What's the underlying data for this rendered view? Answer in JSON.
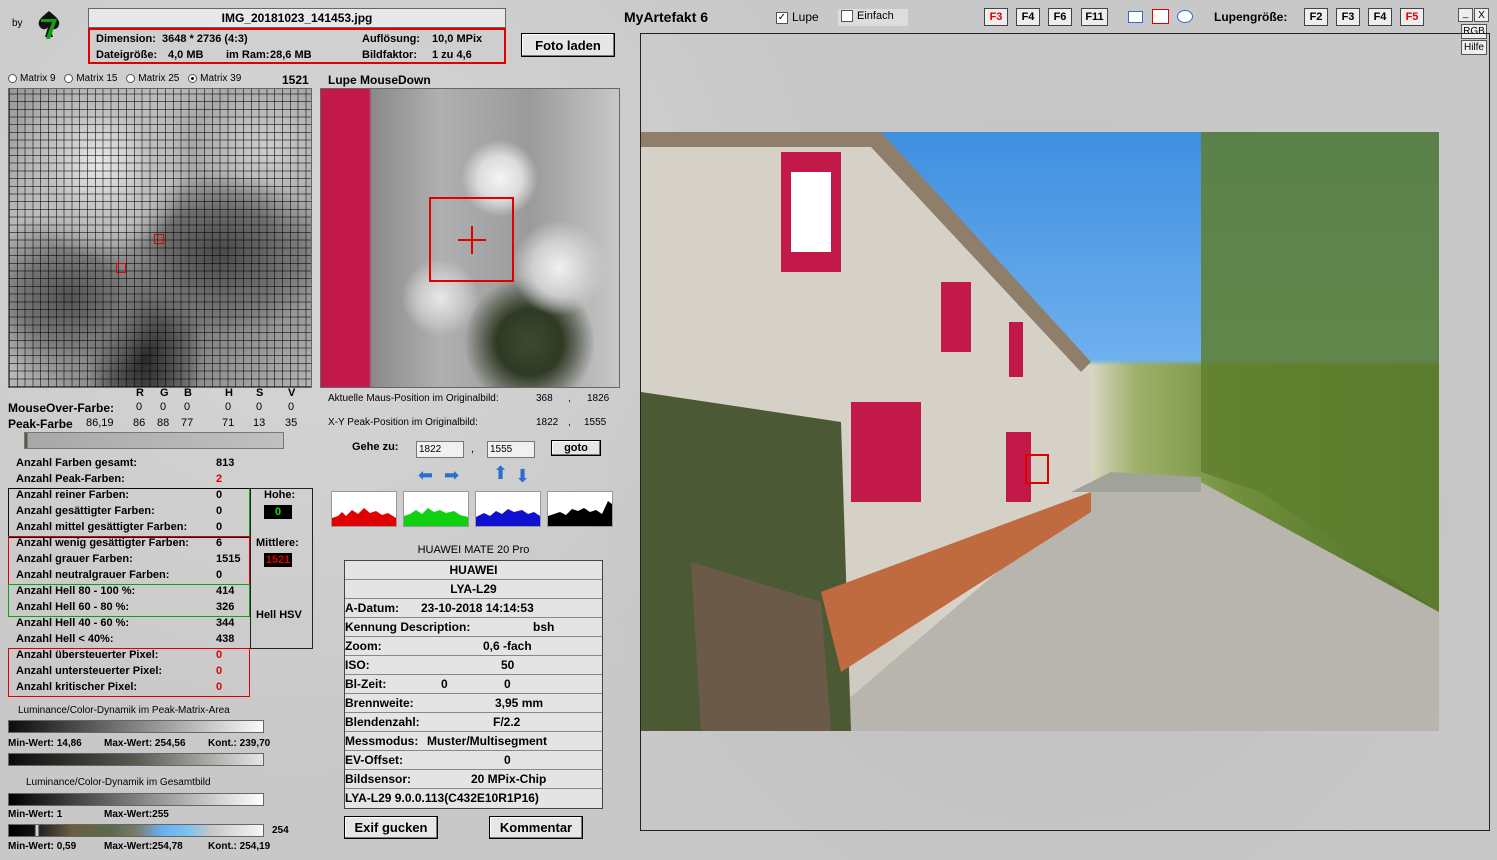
{
  "header": {
    "by_label": "by",
    "filename": "IMG_20181023_141453.jpg",
    "dimension_label": "Dimension:",
    "dimension_value": "3648 * 2736 (4:3)",
    "resolution_label": "Auflösung:",
    "resolution_value": "10,0 MPix",
    "filesize_label": "Dateigröße:",
    "filesize_value": "4,0 MB",
    "ram_label": "im Ram:",
    "ram_value": "28,6 MB",
    "factor_label": "Bildfaktor:",
    "factor_value": "1 zu 4,6",
    "load_photo_button": "Foto laden",
    "app_title": "MyArtefakt 6",
    "lupe_label": "Lupe",
    "lupe_checked": true,
    "einfach_label": "Einfach",
    "einfach_checked": false,
    "fkeys_left": [
      "F3",
      "F4",
      "F6",
      "F11"
    ],
    "lupengroesse_label": "Lupengröße:",
    "fkeys_right": [
      "F2",
      "F3",
      "F4",
      "F5"
    ],
    "side_buttons": [
      "_",
      "X",
      "RGB",
      "Hilfe"
    ]
  },
  "matrix": {
    "options": [
      "Matrix 9",
      "Matrix 15",
      "Matrix 25",
      "Matrix 39"
    ],
    "selected": "Matrix 39",
    "value": "1521"
  },
  "lupe": {
    "title": "Lupe MouseDown",
    "mouse_pos_label": "Aktuelle Maus-Position  im Originalbild:",
    "mouse_pos_x": "368",
    "mouse_pos_y": "1826",
    "peak_pos_label": "X-Y Peak-Position  im Originalbild:",
    "peak_pos_x": "1822",
    "peak_pos_y": "1555",
    "goto_label": "Gehe zu:",
    "goto_x": "1822",
    "goto_y": "1555",
    "goto_button": "goto",
    "comma": ","
  },
  "colors": {
    "headers": [
      "R",
      "G",
      "B",
      "H",
      "S",
      "V"
    ],
    "mouseover_label": "MouseOver-Farbe:",
    "mouseover_values": [
      "0",
      "0",
      "0",
      "0",
      "0",
      "0"
    ],
    "peak_label": "Peak-Farbe",
    "peak_prefix": "86,19",
    "peak_values": [
      "86",
      "88",
      "77",
      "71",
      "13",
      "35"
    ],
    "peak_color": "#565849"
  },
  "stats": [
    {
      "label": "Anzahl Farben gesamt:",
      "value": "813",
      "red": false
    },
    {
      "label": "Anzahl Peak-Farben:",
      "value": "2",
      "red": true
    },
    {
      "label": "Anzahl reiner Farben:",
      "value": "0",
      "red": false
    },
    {
      "label": "Anzahl gesättigter Farben:",
      "value": "0",
      "red": false
    },
    {
      "label": "Anzahl mittel gesättigter Farben:",
      "value": "0",
      "red": false
    },
    {
      "label": "Anzahl wenig gesättigter Farben:",
      "value": "6",
      "red": false
    },
    {
      "label": "Anzahl grauer Farben:",
      "value": "1515",
      "red": false
    },
    {
      "label": "Anzahl neutralgrauer Farben:",
      "value": "0",
      "red": false
    },
    {
      "label": "Anzahl Hell 80 - 100 %:",
      "value": "414",
      "red": false
    },
    {
      "label": "Anzahl Hell 60 - 80 %:",
      "value": "326",
      "red": false
    },
    {
      "label": "Anzahl Hell 40 - 60 %:",
      "value": "344",
      "red": false
    },
    {
      "label": "Anzahl Hell < 40%:",
      "value": "438",
      "red": false
    },
    {
      "label": "Anzahl übersteuerter Pixel:",
      "value": "0",
      "red": true
    },
    {
      "label": "Anzahl untersteuerter Pixel:",
      "value": "0",
      "red": true
    },
    {
      "label": "Anzahl kritischer Pixel:",
      "value": "0",
      "red": true
    }
  ],
  "side_labels": {
    "hohe": "Hohe:",
    "hohe_value": "0",
    "mittlere": "Mittlere:",
    "mittlere_value": "1521",
    "hell_hsv": "Hell HSV"
  },
  "dynamics": {
    "peak_title": "Luminance/Color-Dynamik im Peak-Matrix-Area",
    "peak_min": "Min-Wert: 14,86",
    "peak_max": "Max-Wert: 254,56",
    "peak_kont": "Kont.: 239,70",
    "total_title": "Luminance/Color-Dynamik im Gesamtbild",
    "total_min": "Min-Wert: 1",
    "total_max": "Max-Wert:255",
    "bar_value": "254",
    "bottom_min": "Min-Wert: 0,59",
    "bottom_max": "Max-Wert:254,78",
    "bottom_kont": "Kont.: 254,19"
  },
  "exif": {
    "camera_title": "HUAWEI MATE 20 Pro",
    "make": "HUAWEI",
    "model": "LYA-L29",
    "rows": [
      {
        "label": "A-Datum:",
        "value": "23-10-2018 14:14:53"
      },
      {
        "label": "Kennung Description:",
        "value": "bsh"
      },
      {
        "label": "Zoom:",
        "value": "0,6 -fach"
      },
      {
        "label": "ISO:",
        "value": "50"
      },
      {
        "label": "Bl-Zeit:",
        "value": "0",
        "value2": "0"
      },
      {
        "label": "Brennweite:",
        "value": "3,95  mm"
      },
      {
        "label": "Blendenzahl:",
        "value": "F/2.2"
      },
      {
        "label": "Messmodus:",
        "value": "Muster/Multisegment"
      },
      {
        "label": "EV-Offset:",
        "value": "0"
      },
      {
        "label": "Bildsensor:",
        "value": "20 MPix-Chip"
      }
    ],
    "firmware": "LYA-L29 9.0.0.113(C432E10R1P16)",
    "exif_button": "Exif gucken",
    "comment_button": "Kommentar"
  },
  "icons": [
    "logo-icon",
    "arrow-left-icon",
    "arrow-right-icon",
    "arrow-up-icon",
    "arrow-down-icon",
    "rectangle-shape-icon",
    "circle-shape-icon"
  ]
}
